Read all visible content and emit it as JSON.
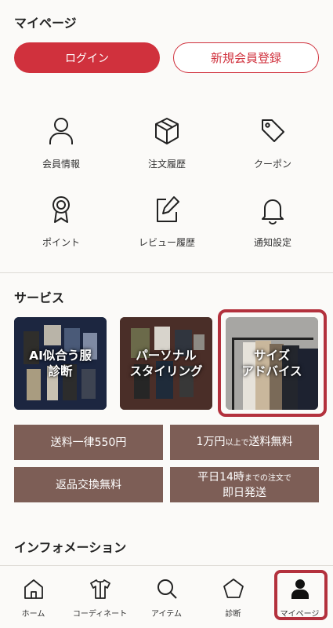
{
  "mypage": {
    "title": "マイページ",
    "login_label": "ログイン",
    "register_label": "新規会員登録"
  },
  "menu": [
    {
      "label": "会員情報",
      "icon": "user-icon"
    },
    {
      "label": "注文履歴",
      "icon": "box-icon"
    },
    {
      "label": "クーポン",
      "icon": "tag-icon"
    },
    {
      "label": "ポイント",
      "icon": "medal-icon"
    },
    {
      "label": "レビュー履歴",
      "icon": "edit-icon"
    },
    {
      "label": "通知設定",
      "icon": "bell-icon"
    }
  ],
  "services": {
    "title": "サービス",
    "cards": [
      {
        "title": "AI似合う服\n診断"
      },
      {
        "title": "パーソナル\nスタイリング"
      },
      {
        "title": "サイズ\nアドバイス"
      }
    ]
  },
  "features": {
    "shipping_flat": "送料一律550円",
    "free_shipping_amount": "1万円",
    "free_shipping_mid": "以上で",
    "free_shipping_end": "送料無料",
    "returns": "返品交換無料",
    "sameday_pre": "平日14時",
    "sameday_mid": "までの注文で",
    "sameday_line2": "即日発送"
  },
  "info": {
    "title": "インフォメーション"
  },
  "tabs": [
    {
      "label": "ホーム",
      "icon": "home-icon"
    },
    {
      "label": "コーディネート",
      "icon": "shirt-icon"
    },
    {
      "label": "アイテム",
      "icon": "search-icon"
    },
    {
      "label": "診断",
      "icon": "pentagon-icon"
    },
    {
      "label": "マイページ",
      "icon": "person-icon"
    }
  ],
  "colors": {
    "accent": "#d0313d",
    "feature_bg": "#7d5e56",
    "highlight_border": "#b3313d"
  }
}
